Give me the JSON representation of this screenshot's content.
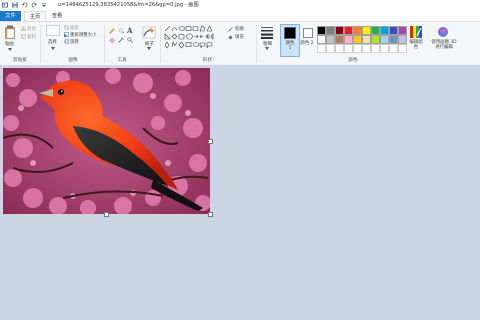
{
  "window": {
    "title": "u=1484625129,3835421058&fm=26&gp=0.jpg - 画图"
  },
  "tabs": {
    "file": "文件",
    "home": "主页",
    "view": "查看"
  },
  "clipboard": {
    "paste": "粘贴",
    "cut": "剪切",
    "copy": "复制",
    "label": "剪贴板"
  },
  "image_group": {
    "select": "选择",
    "crop": "裁剪",
    "resize": "重新调整大小",
    "rotate": "旋转",
    "label": "图像"
  },
  "tools": {
    "label": "工具"
  },
  "brushes": {
    "label": "刷子"
  },
  "shapes": {
    "outline": "轮廓",
    "fill": "填充",
    "label": "形状"
  },
  "size": {
    "label": "粗细"
  },
  "colors": {
    "color1": "颜色 1",
    "color2": "颜色 2",
    "edit": "编辑颜色",
    "paint3d": "使用画图 3D 进行编辑",
    "label": "颜色",
    "palette_row1": [
      "#000000",
      "#7f7f7f",
      "#880015",
      "#ed1c24",
      "#ff7f27",
      "#fff200",
      "#22b14c",
      "#00a2e8",
      "#3f48cc",
      "#a349a4"
    ],
    "palette_row2": [
      "#ffffff",
      "#c3c3c3",
      "#b97a57",
      "#ffaec9",
      "#ffc90e",
      "#efe4b0",
      "#b5e61d",
      "#99d9ea",
      "#7092be",
      "#c8bfe7"
    ]
  }
}
